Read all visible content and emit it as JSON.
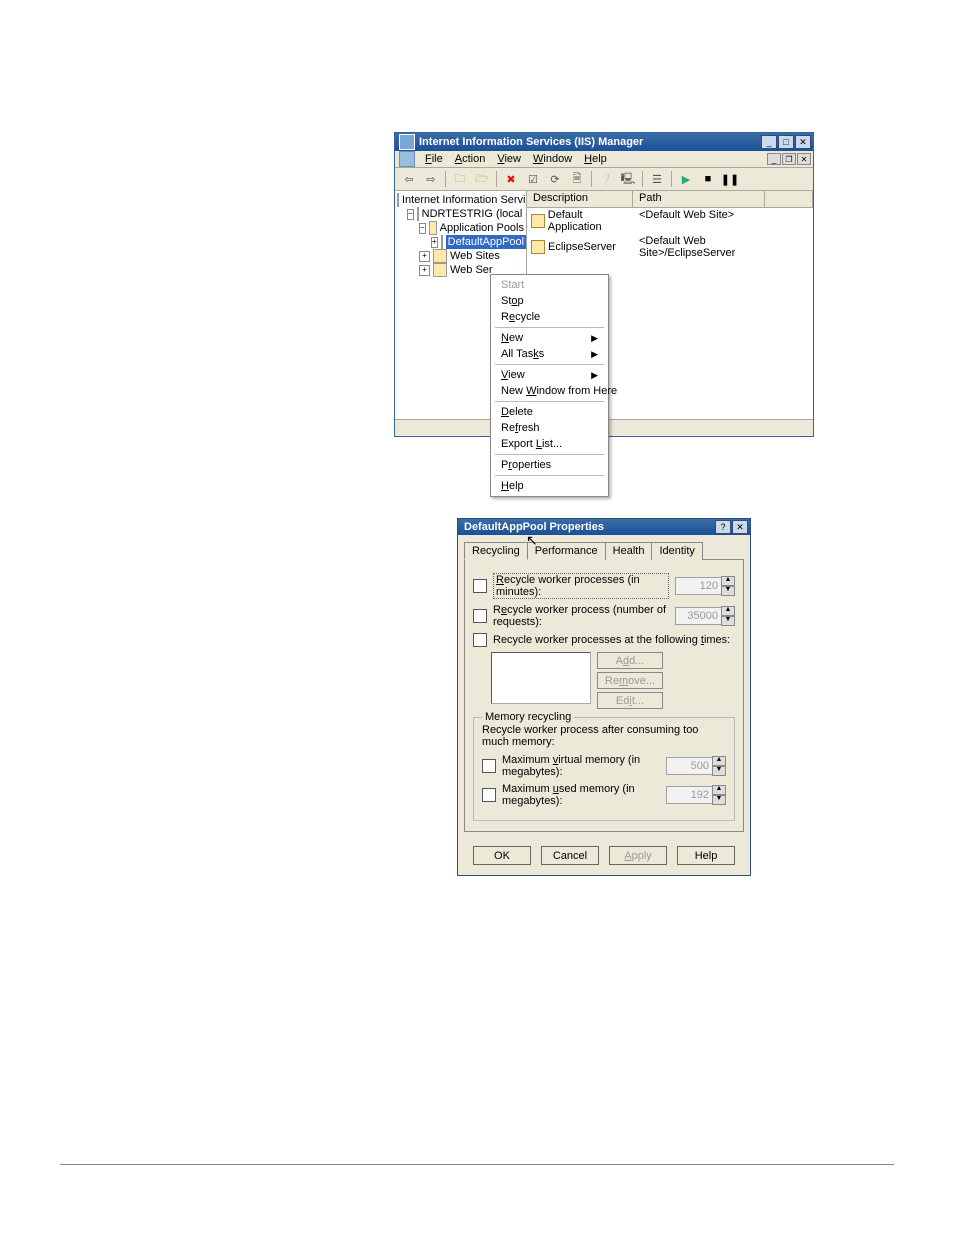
{
  "iis": {
    "title": "Internet Information Services (IIS) Manager",
    "menu": {
      "file": "File",
      "action": "Action",
      "view": "View",
      "window": "Window",
      "help": "Help"
    },
    "tree": {
      "root": "Internet Information Services",
      "server": "NDRTESTRIG (local computer)",
      "app_pools": "Application Pools",
      "default_pool": "DefaultAppPool",
      "web_sites": "Web Sites",
      "web_serv": "Web Ser"
    },
    "list_headers": {
      "description": "Description",
      "path": "Path",
      "blank": ""
    },
    "list_rows": [
      {
        "desc": "Default Application",
        "path": "<Default Web Site>"
      },
      {
        "desc": "EclipseServer",
        "path": "<Default Web Site>/EclipseServer"
      }
    ],
    "context_menu": {
      "start": "Start",
      "stop": "Stop",
      "recycle": "Recycle",
      "new": "New",
      "all_tasks": "All Tasks",
      "view": "View",
      "new_window": "New Window from Here",
      "delete": "Delete",
      "refresh": "Refresh",
      "export": "Export List...",
      "properties": "Properties",
      "help": "Help"
    }
  },
  "props": {
    "title": "DefaultAppPool Properties",
    "tabs": {
      "recycling": "Recycling",
      "performance": "Performance",
      "health": "Health",
      "identity": "Identity"
    },
    "chk_minutes": "Recycle worker processes (in minutes):",
    "val_minutes": "120",
    "chk_requests": "Recycle worker process (number of requests):",
    "val_requests": "35000",
    "chk_times": "Recycle worker processes at the following times:",
    "btn_add": "Add...",
    "btn_remove": "Remove...",
    "btn_edit": "Edit...",
    "memory_group": "Memory recycling",
    "memory_note": "Recycle worker process after consuming too much memory:",
    "chk_vmem": "Maximum virtual memory (in megabytes):",
    "val_vmem": "500",
    "chk_umem": "Maximum used memory (in megabytes):",
    "val_umem": "192",
    "btn_ok": "OK",
    "btn_cancel": "Cancel",
    "btn_apply": "Apply",
    "btn_help": "Help"
  }
}
